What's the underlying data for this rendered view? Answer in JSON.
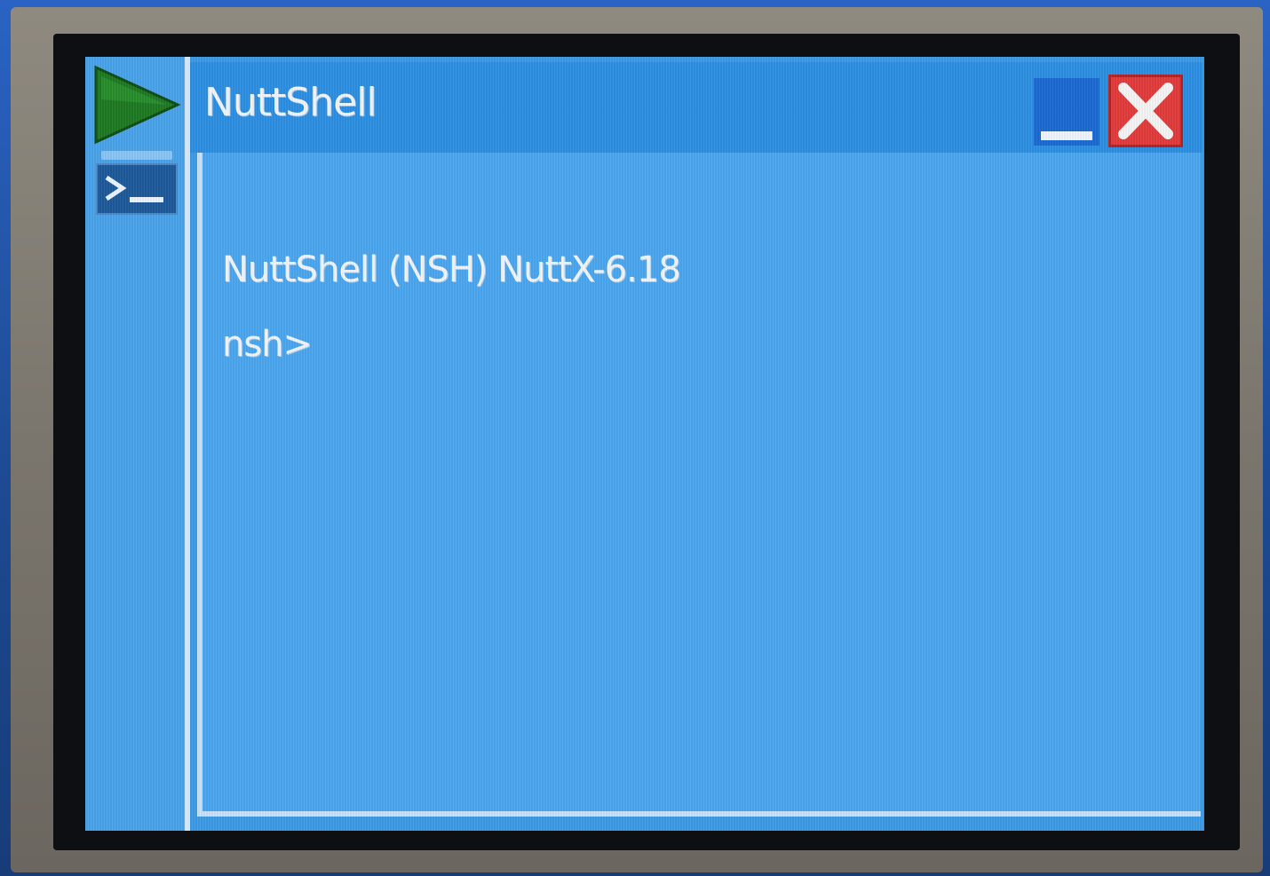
{
  "window": {
    "title": "NuttShell"
  },
  "terminal": {
    "lines": [
      "NuttShell (NSH) NuttX-6.18",
      "nsh>"
    ]
  },
  "icons": {
    "start": "start-play-icon",
    "app": "terminal-prompt-icon",
    "minimize": "minimize-icon",
    "close": "close-icon"
  },
  "colors": {
    "screen_background": "#3d9be6",
    "titlebar": "#2d8fe3",
    "start_icon": "#1f7a22",
    "close_button": "#e23b3b",
    "text": "#f2f7fd"
  }
}
